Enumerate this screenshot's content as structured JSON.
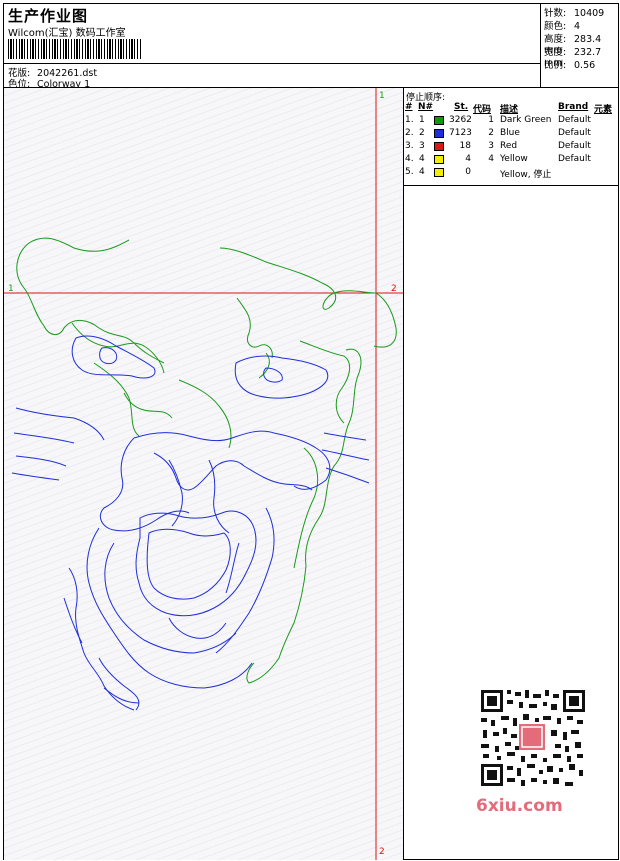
{
  "header": {
    "title": "生产作业图",
    "company": "Wilcom(汇宝) 数码工作室",
    "design_label": "花版:",
    "design_value": "2042261.dst",
    "color_label": "色位:",
    "color_value": "Colorway 1"
  },
  "stats": [
    {
      "label": "针数:",
      "value": "10409"
    },
    {
      "label": "颜色:",
      "value": "4"
    },
    {
      "label": "高度:",
      "value": "283.4 mm"
    },
    {
      "label": "宽度:",
      "value": "232.7 mm"
    },
    {
      "label": "比例:",
      "value": "0.56"
    }
  ],
  "stop_sequence": {
    "title": "停止顺序:",
    "columns": [
      "#",
      "N#",
      "St.",
      "代码",
      "描述",
      "Brand",
      "元素"
    ],
    "rows": [
      {
        "index": "1.",
        "n": "1",
        "color": "#0a9a0a",
        "st": "3262",
        "code": "1",
        "desc": "Dark Green",
        "brand": "Default"
      },
      {
        "index": "2.",
        "n": "2",
        "color": "#1f2fd8",
        "st": "7123",
        "code": "2",
        "desc": "Blue",
        "brand": "Default"
      },
      {
        "index": "3.",
        "n": "3",
        "color": "#e01515",
        "st": "18",
        "code": "3",
        "desc": "Red",
        "brand": "Default"
      },
      {
        "index": "4.",
        "n": "4",
        "color": "#f2ee00",
        "st": "4",
        "code": "4",
        "desc": "Yellow",
        "brand": "Default"
      },
      {
        "index": "5.",
        "n": "4",
        "color": "#f2ee00",
        "st": "0",
        "code": "",
        "desc": "Yellow, 停止",
        "brand": ""
      }
    ]
  },
  "markers": {
    "green_1": "1",
    "red_2": "2"
  },
  "watermark": "6xiu.com",
  "stroke_colors": {
    "green": "#1a9a1a",
    "blue": "#1f2fd8",
    "red": "#d11"
  }
}
